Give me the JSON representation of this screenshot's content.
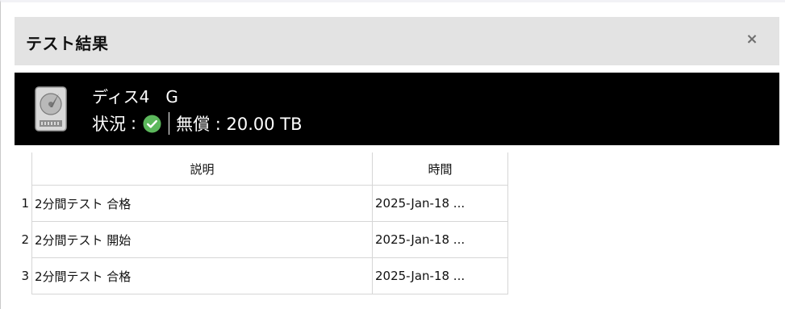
{
  "window": {
    "title": "テスト結果",
    "close_symbol": "×"
  },
  "disk": {
    "name": "ディス4　G",
    "status_label": "状況",
    "status_colon": ":",
    "status_icon": "check-circle-icon",
    "status_color": "#5cb85c",
    "warranty": "無償 : 20.00 TB"
  },
  "table": {
    "headers": [
      "説明",
      "時間"
    ],
    "rows": [
      {
        "index": "1",
        "description": "2分間テスト 合格",
        "time": "2025-Jan-18 ..."
      },
      {
        "index": "2",
        "description": "2分間テスト 開始",
        "time": "2025-Jan-18 ..."
      },
      {
        "index": "3",
        "description": "2分間テスト 合格",
        "time": "2025-Jan-18 ..."
      }
    ]
  }
}
